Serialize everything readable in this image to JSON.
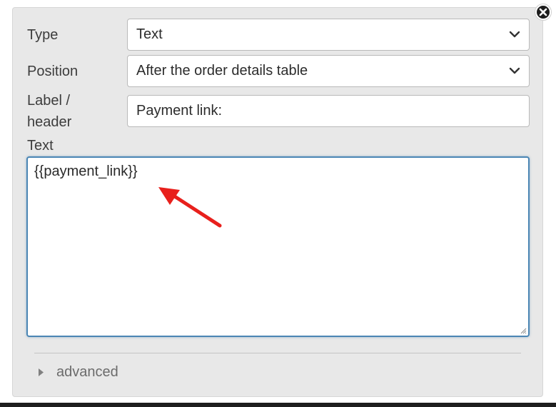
{
  "form": {
    "type": {
      "label": "Type",
      "value": "Text"
    },
    "position": {
      "label": "Position",
      "value": "After the order details table"
    },
    "label_header": {
      "label_line1": "Label /",
      "label_line2": "header",
      "value": "Payment link:"
    },
    "text": {
      "label": "Text",
      "value": "{{payment_link}}"
    }
  },
  "advanced": {
    "label": "advanced"
  },
  "colors": {
    "panel_bg": "#e8e8e8",
    "focus_border": "#4b86b4",
    "annotation_arrow": "#e8201c"
  },
  "icons": {
    "close": "close-icon",
    "dropdown": "chevron-down-icon",
    "disclosure": "triangle-right-icon",
    "annotation": "red-arrow-icon"
  }
}
